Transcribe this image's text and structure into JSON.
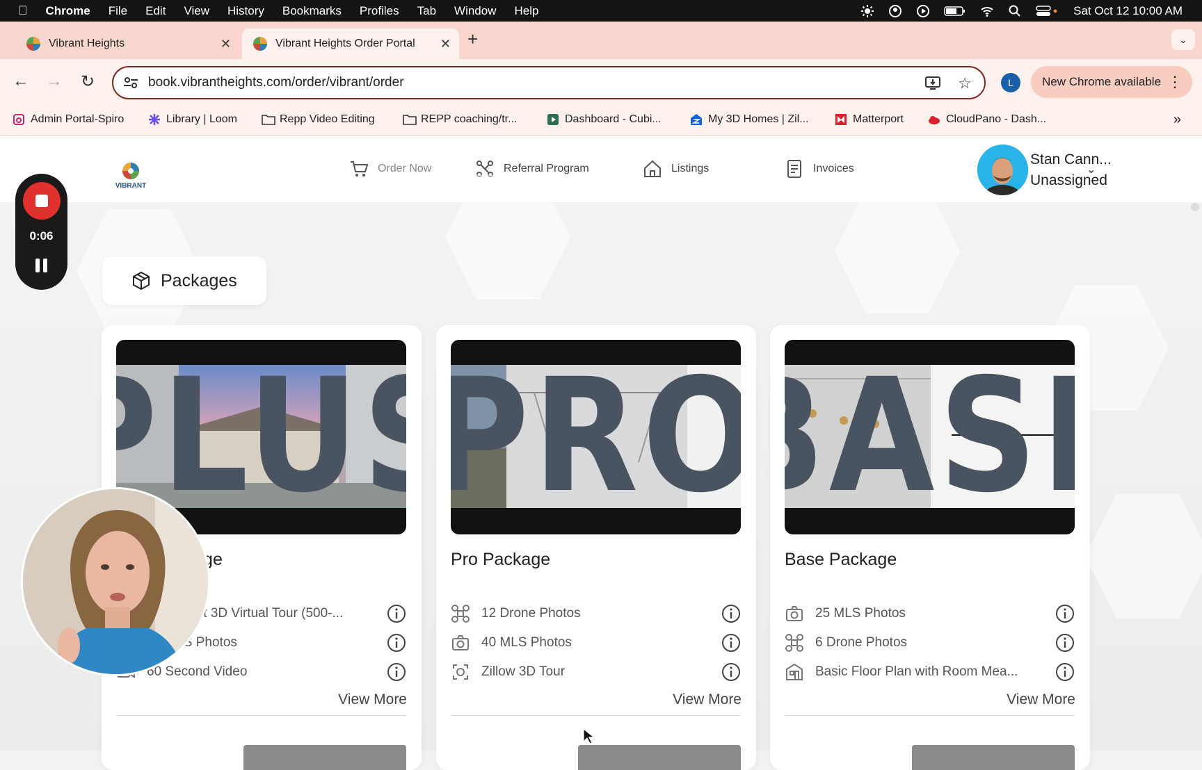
{
  "menubar": {
    "app": "Chrome",
    "items": [
      "File",
      "Edit",
      "View",
      "History",
      "Bookmarks",
      "Profiles",
      "Tab",
      "Window",
      "Help"
    ],
    "clock": "Sat Oct 12  10:00 AM"
  },
  "tabs": [
    {
      "title": "Vibrant Heights"
    },
    {
      "title": "Vibrant Heights Order Portal"
    }
  ],
  "toolbar": {
    "url": "book.vibrantheights.com/order/vibrant/order",
    "profile_initial": "L",
    "update_label": "New Chrome available"
  },
  "bookmarks": [
    {
      "label": "Admin Portal-Spiro"
    },
    {
      "label": "Library | Loom"
    },
    {
      "label": "Repp Video Editing"
    },
    {
      "label": "REPP coaching/tr..."
    },
    {
      "label": "Dashboard - Cubi..."
    },
    {
      "label": "My 3D Homes | Zil..."
    },
    {
      "label": "Matterport"
    },
    {
      "label": "CloudPano - Dash..."
    }
  ],
  "site": {
    "logo_text": "VIBRANT",
    "nav": [
      {
        "label": "Order Now",
        "icon": "cart-icon"
      },
      {
        "label": "Referral Program",
        "icon": "referral-icon"
      },
      {
        "label": "Listings",
        "icon": "home-icon"
      },
      {
        "label": "Invoices",
        "icon": "invoice-icon"
      }
    ],
    "user": {
      "name": "Stan Cann...",
      "role": "Unassigned"
    }
  },
  "section_title": "Packages",
  "packages": [
    {
      "thumb_word": "PLUS",
      "title": "Plus Package",
      "features": [
        {
          "label": "Matterport 3D Virtual Tour (500-...",
          "icon": "matterport-icon"
        },
        {
          "label": "40 MLS Photos",
          "icon": "camera-icon"
        },
        {
          "label": "60 Second Video",
          "icon": "video-icon"
        }
      ],
      "view_more": "View More"
    },
    {
      "thumb_word": "PRO",
      "title": "Pro Package",
      "features": [
        {
          "label": "12 Drone Photos",
          "icon": "drone-icon"
        },
        {
          "label": "40 MLS Photos",
          "icon": "camera-icon"
        },
        {
          "label": "Zillow 3D Tour",
          "icon": "tour-3d-icon"
        }
      ],
      "view_more": "View More"
    },
    {
      "thumb_word": "BASE",
      "title": "Base Package",
      "features": [
        {
          "label": "25 MLS Photos",
          "icon": "camera-icon"
        },
        {
          "label": "6 Drone Photos",
          "icon": "drone-icon"
        },
        {
          "label": "Basic Floor Plan with Room Mea...",
          "icon": "floorplan-icon"
        }
      ],
      "view_more": "View More"
    }
  ],
  "recorder": {
    "time": "0:06"
  },
  "colors": {
    "accent_red": "#e0322c",
    "tabstrip": "#f9d6cd",
    "toolbar": "#fdf1ed"
  }
}
